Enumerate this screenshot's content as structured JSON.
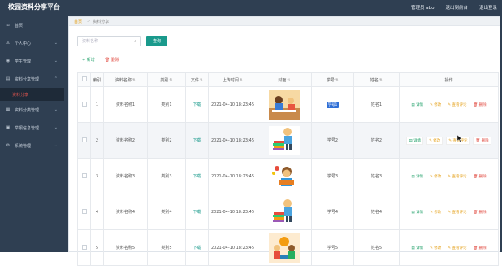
{
  "header": {
    "title": "校园资料分享平台",
    "links": [
      "管理员 abo",
      "退出到前台",
      "退出登录"
    ]
  },
  "sidebar": {
    "items": [
      {
        "label": "首页",
        "icon": "home-icon",
        "chevron": false
      },
      {
        "label": "个人中心",
        "icon": "user-icon",
        "chevron": true
      },
      {
        "label": "学生管理",
        "icon": "users-icon",
        "chevron": true
      },
      {
        "label": "资料分享管理",
        "icon": "folder-icon",
        "chevron": true
      }
    ],
    "sub_item": "资料分享",
    "items_after": [
      {
        "label": "资料分类管理",
        "icon": "list-icon",
        "chevron": true
      },
      {
        "label": "举报信息管理",
        "icon": "report-icon",
        "chevron": true
      },
      {
        "label": "系统管理",
        "icon": "settings-icon",
        "chevron": true
      }
    ]
  },
  "breadcrumb": {
    "home": "首页",
    "separator": ">",
    "current": "资料分享"
  },
  "search": {
    "placeholder": "资料名称",
    "button": "查询"
  },
  "actions": {
    "add": "+ 新增",
    "delete": "删除"
  },
  "table": {
    "columns": [
      "",
      "索引",
      "资料名称",
      "类别",
      "文件",
      "上传时间",
      "封面",
      "学号",
      "姓名",
      "操作"
    ],
    "rows": [
      {
        "index": "1",
        "name": "资料名称1",
        "category": "类别1",
        "file": "下载",
        "time": "2021-04-10 18:23:45",
        "pic": "picture-kids-desk",
        "student_no": "学号1",
        "student_tag": true,
        "student_name": "姓名1"
      },
      {
        "index": "2",
        "name": "资料名称2",
        "category": "类别2",
        "file": "下载",
        "time": "2021-04-10 18:23:45",
        "pic": "picture-books",
        "student_no": "学号2",
        "student_tag": false,
        "student_name": "姓名2"
      },
      {
        "index": "3",
        "name": "资料名称3",
        "category": "类别3",
        "file": "下载",
        "time": "2021-04-10 18:23:45",
        "pic": "picture-reading-boy",
        "student_no": "学号3",
        "student_tag": false,
        "student_name": "姓名3"
      },
      {
        "index": "4",
        "name": "资料名称4",
        "category": "类别4",
        "file": "下载",
        "time": "2021-04-10 18:23:45",
        "pic": "picture-books",
        "student_no": "学号4",
        "student_tag": false,
        "student_name": "姓名4"
      },
      {
        "index": "5",
        "name": "资料名称5",
        "category": "类别5",
        "file": "下载",
        "time": "2021-04-10 18:23:45",
        "pic": "picture-kids-cover",
        "student_no": "学号5",
        "student_tag": false,
        "student_name": "姓名5"
      }
    ],
    "ops": {
      "view": "详情",
      "edit": "修改",
      "share": "查看评论",
      "delete": "删除"
    }
  },
  "colors": {
    "header_bg": "#2f3f52",
    "accent": "#1a9a8c",
    "danger": "#e14d43",
    "warn": "#e49f16"
  }
}
